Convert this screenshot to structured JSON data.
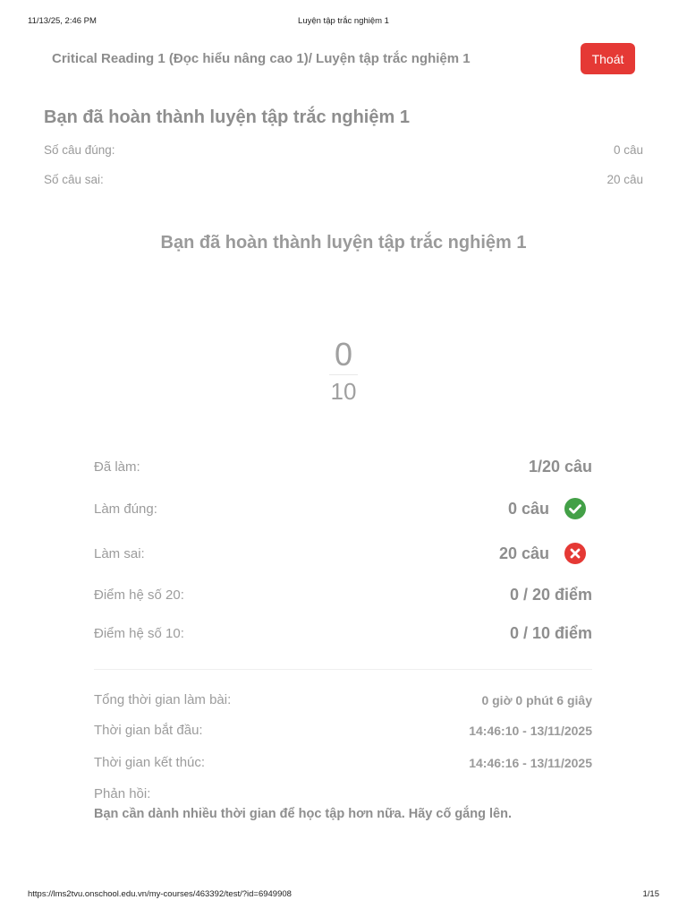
{
  "print_header": {
    "datetime": "11/13/25, 2:46 PM",
    "title": "Luyện tập trắc nghiệm 1"
  },
  "topbar": {
    "course_title": "Critical Reading 1 (Đọc hiểu nâng cao 1)/ Luyện tập trắc nghiệm 1",
    "exit_label": "Thoát",
    "exit_color": "#e53935"
  },
  "summary": {
    "title": "Bạn đã hoàn thành luyện tập trắc nghiệm 1",
    "correct_label": "Số câu đúng:",
    "correct_value": "0 câu",
    "wrong_label": "Số câu sai:",
    "wrong_value": "20 câu"
  },
  "result": {
    "title": "Bạn đã hoàn thành luyện tập trắc nghiệm 1",
    "score": "0",
    "max_score": "10"
  },
  "stats": {
    "done_label": "Đã làm:",
    "done_value": "1/20 câu",
    "correct_label": "Làm đúng:",
    "correct_value": "0 câu",
    "correct_icon": "check-circle-icon",
    "correct_color": "#43a047",
    "wrong_label": "Làm sai:",
    "wrong_value": "20 câu",
    "wrong_icon": "x-circle-icon",
    "wrong_color": "#e53935",
    "score20_label": "Điểm hệ số 20:",
    "score20_value": "0 / 20 điểm",
    "score10_label": "Điểm hệ số 10:",
    "score10_value": "0 / 10 điểm"
  },
  "timing": {
    "total_label": "Tổng thời gian làm bài:",
    "total_value": "0 giờ 0 phút 6 giây",
    "start_label": "Thời gian bắt đầu:",
    "start_value": "14:46:10 - 13/11/2025",
    "end_label": "Thời gian kết thúc:",
    "end_value": "14:46:16 - 13/11/2025"
  },
  "feedback": {
    "label": "Phản hồi:",
    "text": "Bạn cần dành nhiều thời gian để học tập hơn nữa. Hãy cố gắng lên."
  },
  "print_footer": {
    "url": "https://lms2tvu.onschool.edu.vn/my-courses/463392/test/?id=6949908",
    "page": "1/15"
  }
}
